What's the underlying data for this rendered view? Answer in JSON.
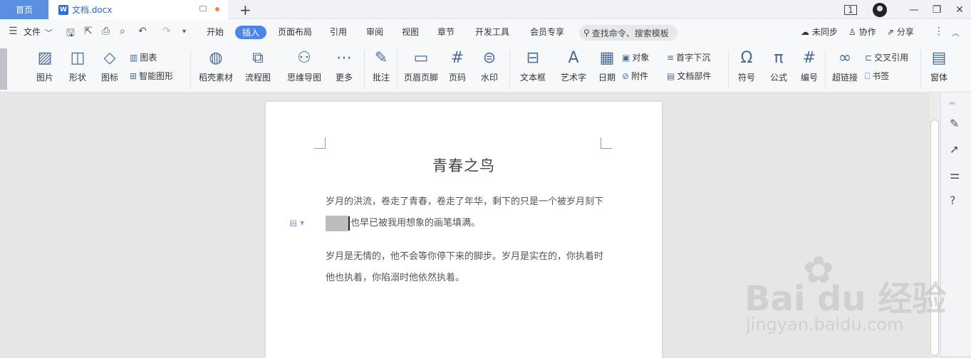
{
  "tabs": {
    "home": "首页",
    "doc_name": "文档.docx",
    "new_tab": "+"
  },
  "window": {
    "badge": "1",
    "minimize": "—",
    "restore": "❐",
    "close": "✕"
  },
  "menu": {
    "file": "文件",
    "items": [
      "开始",
      "插入",
      "页面布局",
      "引用",
      "审阅",
      "视图",
      "章节",
      "开发工具",
      "会员专享"
    ],
    "active": "插入",
    "search": "查找命令、搜索模板",
    "unsynced": "未同步",
    "collab": "协作",
    "share": "分享"
  },
  "ribbon": {
    "picture": "图片",
    "shape": "形状",
    "icon": "图标",
    "chart": "图表",
    "smart_graphic": "智能图形",
    "straw_material": "稻壳素材",
    "flowchart": "流程图",
    "mindmap": "思维导图",
    "more": "更多",
    "comment": "批注",
    "header_footer": "页眉页脚",
    "page_number": "页码",
    "watermark": "水印",
    "textbox": "文本框",
    "wordart": "艺术字",
    "date": "日期",
    "object": "对象",
    "attachment": "附件",
    "dropcap": "首字下沉",
    "doc_parts": "文档部件",
    "symbol": "符号",
    "formula": "公式",
    "numbering": "编号",
    "hyperlink": "超链接",
    "crossref": "交叉引用",
    "bookmark": "书签",
    "window": "窗体"
  },
  "document": {
    "title": "青春之鸟",
    "p1_line1": "岁月的洪流，卷走了青春，卷走了年华，剩下的只是一个被岁月刻下",
    "p1_line2": "也早已被我用想象的画笔填满。",
    "p2_line1": "岁月是无情的，他不会等你停下来的脚步。岁月是实在的，你执着时",
    "p2_line2": "他也执着，你陷溺时他依然执着。"
  },
  "watermark": {
    "brand": "Bai du 经验",
    "url": "jingyan.baidu.com"
  },
  "colors": {
    "accent": "#4a86e8",
    "home_tab": "#5b8fe0",
    "unsaved_dot": "#f08a3c"
  }
}
